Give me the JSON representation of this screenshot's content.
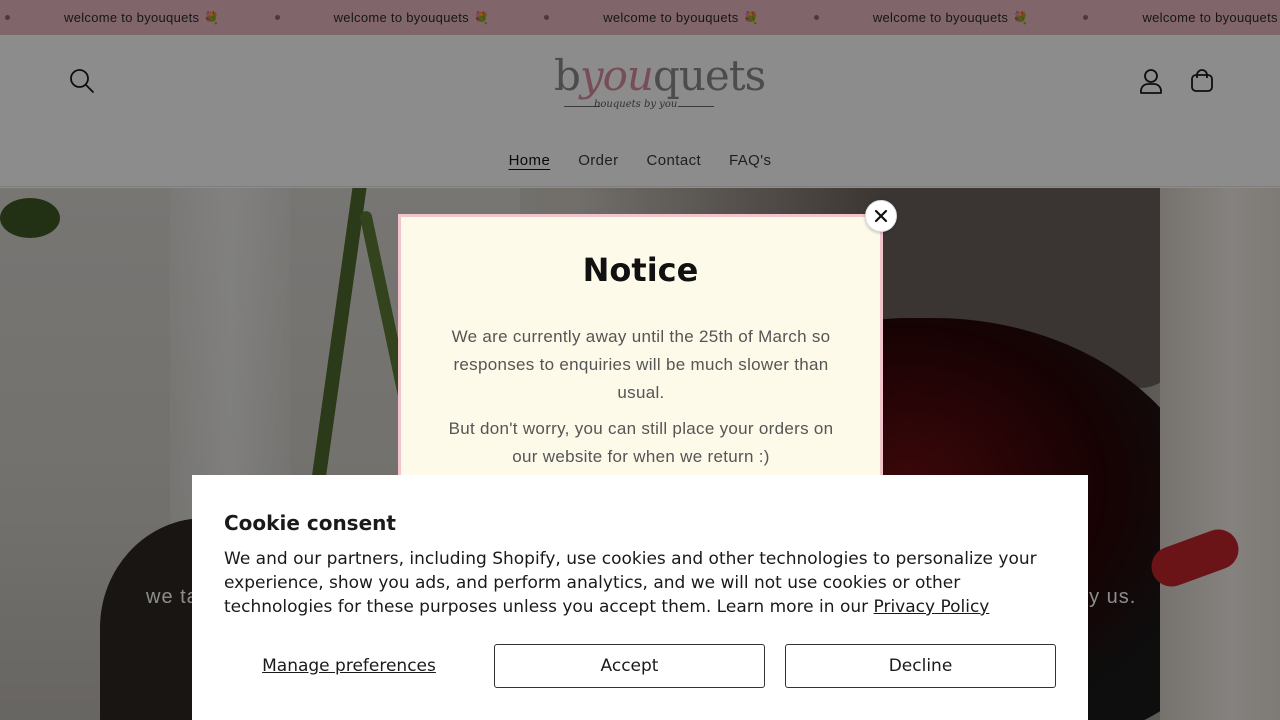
{
  "announcement": {
    "text": "welcome to byouquets",
    "emoji": "💐",
    "repeat_count": 5
  },
  "header": {
    "logo": {
      "brand": "byouquets",
      "tagline": "bouquets by you"
    },
    "nav": [
      {
        "label": "Home",
        "active": true
      },
      {
        "label": "Order",
        "active": false
      },
      {
        "label": "Contact",
        "active": false
      },
      {
        "label": "FAQ's",
        "active": false
      }
    ],
    "icons": [
      "search-icon",
      "account-icon",
      "cart-icon"
    ]
  },
  "hero": {
    "text_left": "we ta",
    "text_right": "by us."
  },
  "notice": {
    "title": "Notice",
    "paragraph1": "We are currently away until the 25th of March so responses to enquiries will be much slower than usual.",
    "paragraph2": "But don't worry, you can still place your orders on our website for when we return :)",
    "close_icon": "close-icon"
  },
  "cookie": {
    "title": "Cookie consent",
    "text": "We and our partners, including Shopify, use cookies and other technologies to personalize your experience, show you ads, and perform analytics, and we will not use cookies or other technologies for these purposes unless you accept them. Learn more in our",
    "link": "Privacy Policy",
    "manage_label": "Manage preferences",
    "accept_label": "Accept",
    "decline_label": "Decline"
  },
  "colors": {
    "announcement_bg": "#e9b8c1",
    "notice_bg": "#fefae9",
    "notice_border": "#f2c5cc",
    "logo_pink": "#d98e9e"
  }
}
